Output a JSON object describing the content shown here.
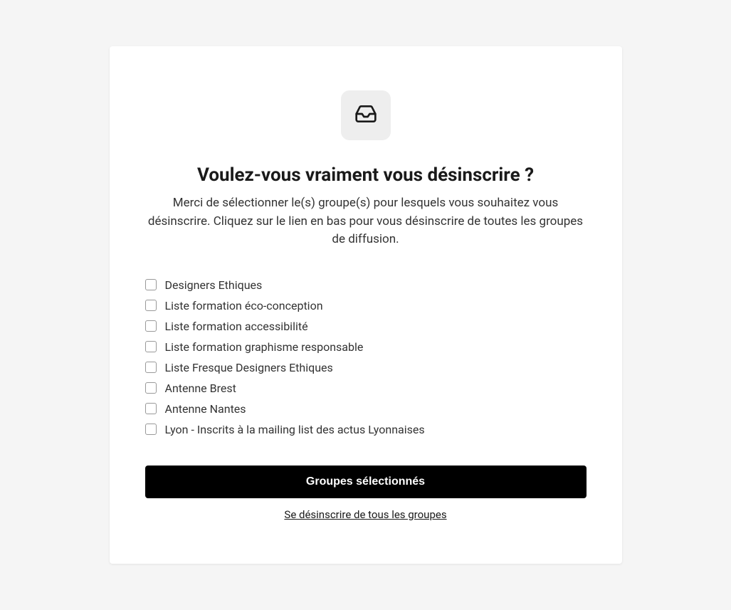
{
  "card": {
    "title": "Voulez-vous vraiment vous désinscrire ?",
    "description": "Merci de sélectionner le(s) groupe(s) pour lesquels vous souhaitez vous désinscrire. Cliquez sur le lien en bas pour vous désinscrire de toutes les groupes de diffusion.",
    "groups": [
      {
        "label": "Designers Ethiques"
      },
      {
        "label": "Liste formation éco-conception"
      },
      {
        "label": "Liste formation accessibilité"
      },
      {
        "label": "Liste formation graphisme responsable"
      },
      {
        "label": "Liste Fresque Designers Ethiques"
      },
      {
        "label": "Antenne Brest"
      },
      {
        "label": "Antenne Nantes"
      },
      {
        "label": "Lyon - Inscrits à la mailing list des actus Lyonnaises"
      }
    ],
    "submit_label": "Groupes sélectionnés",
    "unsubscribe_all_label": "Se désinscrire de tous les groupes"
  }
}
